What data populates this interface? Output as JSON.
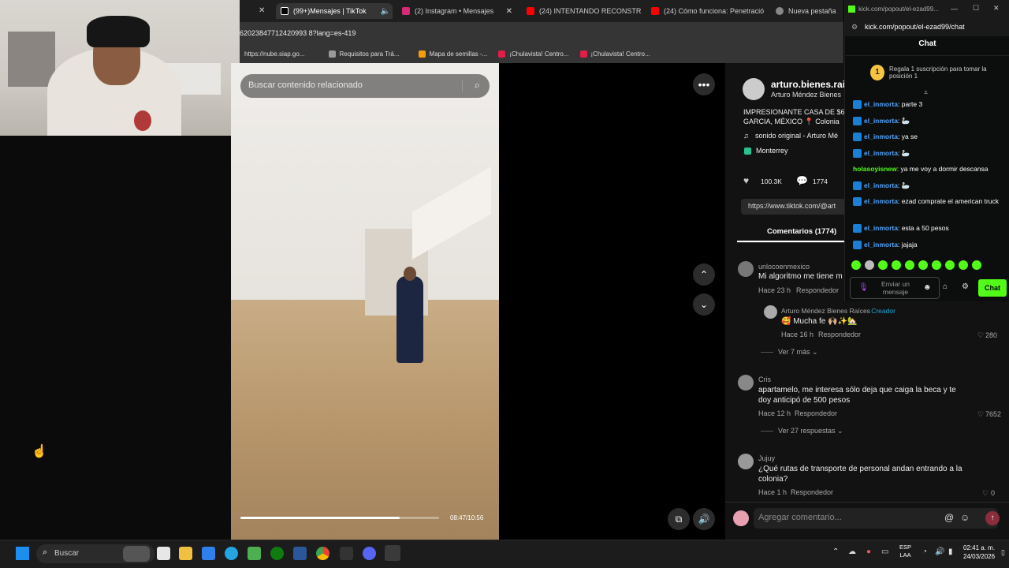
{
  "browser": {
    "tabs": [
      {
        "label": "(99+)Mensajes | TikTok",
        "active": true,
        "color": "#ffffff"
      },
      {
        "label": "(2) Instagram • Mensajes",
        "active": false,
        "color": "#d62976"
      },
      {
        "label": "(24) INTENTANDO RECONSTRU",
        "active": false,
        "color": "#ff0000"
      },
      {
        "label": "(24) Cómo funciona: Penetració",
        "active": false,
        "color": "#ff0000"
      },
      {
        "label": "Nueva pestaña",
        "active": false,
        "color": "#888888"
      }
    ],
    "url": "62023847712420993 8?lang=es-419",
    "bookmarks": [
      {
        "label": "https://nube.siap.go...",
        "color": "#3b82f6"
      },
      {
        "label": "Requisitos para Trá...",
        "color": "#999999"
      },
      {
        "label": "Mapa de semillas -...",
        "color": "#f59e0b"
      },
      {
        "label": "¡Chulavista! Centro...",
        "color": "#e11d48"
      },
      {
        "label": "¡Chulavista! Centro...",
        "color": "#e11d48"
      }
    ]
  },
  "video": {
    "search_placeholder": "Buscar contenido relacionado",
    "time": "08:47/10:56",
    "progress": 0.8
  },
  "post": {
    "username": "arturo.bienes.rai",
    "fullname": "Arturo Méndez Bienes",
    "caption": "IMPRESIONANTE CASA DE $6",
    "caption2": "GARCIA, MÉXICO 📍 Colonia",
    "sound": "sonido original - Arturo Mé",
    "location": "Monterrey",
    "likes": "100.3K",
    "comments_count": "1774",
    "link": "https://www.tiktok.com/@art",
    "comments_tab": "Comentarios (1774)"
  },
  "comments": [
    {
      "user": "unlocoenmexico",
      "text": "Mi algoritmo me tiene m",
      "time": "Hace 23 h",
      "reply": "Respondedor"
    },
    {
      "user": "Arturo Méndez Bienes Raíces",
      "creator": "· Creador",
      "text": "🥰 Mucha fe 🙌🏼✨🏡",
      "time": "Hace 16 h",
      "reply": "Respondedor",
      "likes": "280",
      "more": "Ver 7 más"
    },
    {
      "user": "Cris",
      "text": "apartamelo, me interesa sólo deja que caiga la beca y te",
      "text2": "doy anticipó de 500 pesos",
      "time": "Hace 12 h",
      "reply": "Respondedor",
      "likes": "7652",
      "more": "Ver 27 respuestas"
    },
    {
      "user": "Jujuy",
      "text": "¿Qué rutas de transporte de personal andan entrando a la",
      "text2": "colonia?",
      "time": "Hace 1 h",
      "reply": "Respondedor",
      "likes": "0"
    }
  ],
  "comment_input": {
    "placeholder": "Agregar comentario..."
  },
  "kick": {
    "url_title": "kick.com/popout/el-ezad99...",
    "url": "kick.com/popout/el-ezad99/chat",
    "header": "Chat",
    "gift": "Regala 1 suscripción para tomar la posición 1",
    "gift_rank": "1",
    "messages": [
      {
        "user": "el_inmorta",
        "text": ": parte 3",
        "badge": true
      },
      {
        "user": "el_inmorta",
        "text": ": 🦢",
        "badge": true
      },
      {
        "user": "el_inmorta",
        "text": ": ya se",
        "badge": true
      },
      {
        "user": "el_inmorta",
        "text": ": 🦢",
        "badge": true
      },
      {
        "user": "holasoyisnew",
        "text": ": ya me voy a dormir descansa",
        "badge": false
      },
      {
        "user": "el_inmorta",
        "text": ": 🦢",
        "badge": true
      },
      {
        "user": "el_inmorta",
        "text": ": ezad comprate el american truck",
        "badge": true
      },
      {
        "user": "el_inmorta",
        "text": ": esta a 50 pesos",
        "badge": true
      },
      {
        "user": "el_inmorta",
        "text": ": jajaja",
        "badge": true
      }
    ],
    "input_placeholder": "Enviar un mensaje",
    "chat_button": "Chat"
  },
  "taskbar": {
    "search": "Buscar",
    "lang": "ESP",
    "lang2": "LAA",
    "time": "02:41 a. m.",
    "date": "24/03/2026"
  }
}
